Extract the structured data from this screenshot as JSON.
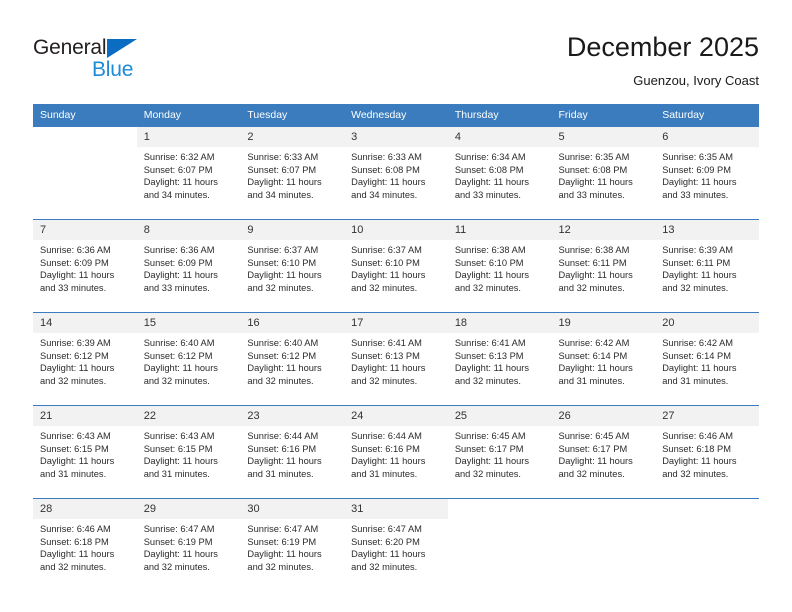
{
  "brand": {
    "name_line1": "General",
    "name_line2": "Blue",
    "triangle_color": "#0a6dc2",
    "blue_color": "#1e8bd6"
  },
  "header": {
    "title": "December 2025",
    "subtitle": "Guenzou, Ivory Coast"
  },
  "theme": {
    "header_blue": "#3a7cbe",
    "daynum_band": "#f2f2f2",
    "text_color": "#2b2b2b"
  },
  "weekday_headers": [
    "Sunday",
    "Monday",
    "Tuesday",
    "Wednesday",
    "Thursday",
    "Friday",
    "Saturday"
  ],
  "labels": {
    "sunrise_prefix": "Sunrise:",
    "sunset_prefix": "Sunset:",
    "daylight_prefix": "Daylight:"
  },
  "weeks": [
    [
      {
        "day": "",
        "sunrise": "",
        "sunset": "",
        "daylight_line1": "",
        "daylight_line2": ""
      },
      {
        "day": "1",
        "sunrise": "Sunrise: 6:32 AM",
        "sunset": "Sunset: 6:07 PM",
        "daylight_line1": "Daylight: 11 hours",
        "daylight_line2": "and 34 minutes."
      },
      {
        "day": "2",
        "sunrise": "Sunrise: 6:33 AM",
        "sunset": "Sunset: 6:07 PM",
        "daylight_line1": "Daylight: 11 hours",
        "daylight_line2": "and 34 minutes."
      },
      {
        "day": "3",
        "sunrise": "Sunrise: 6:33 AM",
        "sunset": "Sunset: 6:08 PM",
        "daylight_line1": "Daylight: 11 hours",
        "daylight_line2": "and 34 minutes."
      },
      {
        "day": "4",
        "sunrise": "Sunrise: 6:34 AM",
        "sunset": "Sunset: 6:08 PM",
        "daylight_line1": "Daylight: 11 hours",
        "daylight_line2": "and 33 minutes."
      },
      {
        "day": "5",
        "sunrise": "Sunrise: 6:35 AM",
        "sunset": "Sunset: 6:08 PM",
        "daylight_line1": "Daylight: 11 hours",
        "daylight_line2": "and 33 minutes."
      },
      {
        "day": "6",
        "sunrise": "Sunrise: 6:35 AM",
        "sunset": "Sunset: 6:09 PM",
        "daylight_line1": "Daylight: 11 hours",
        "daylight_line2": "and 33 minutes."
      }
    ],
    [
      {
        "day": "7",
        "sunrise": "Sunrise: 6:36 AM",
        "sunset": "Sunset: 6:09 PM",
        "daylight_line1": "Daylight: 11 hours",
        "daylight_line2": "and 33 minutes."
      },
      {
        "day": "8",
        "sunrise": "Sunrise: 6:36 AM",
        "sunset": "Sunset: 6:09 PM",
        "daylight_line1": "Daylight: 11 hours",
        "daylight_line2": "and 33 minutes."
      },
      {
        "day": "9",
        "sunrise": "Sunrise: 6:37 AM",
        "sunset": "Sunset: 6:10 PM",
        "daylight_line1": "Daylight: 11 hours",
        "daylight_line2": "and 32 minutes."
      },
      {
        "day": "10",
        "sunrise": "Sunrise: 6:37 AM",
        "sunset": "Sunset: 6:10 PM",
        "daylight_line1": "Daylight: 11 hours",
        "daylight_line2": "and 32 minutes."
      },
      {
        "day": "11",
        "sunrise": "Sunrise: 6:38 AM",
        "sunset": "Sunset: 6:10 PM",
        "daylight_line1": "Daylight: 11 hours",
        "daylight_line2": "and 32 minutes."
      },
      {
        "day": "12",
        "sunrise": "Sunrise: 6:38 AM",
        "sunset": "Sunset: 6:11 PM",
        "daylight_line1": "Daylight: 11 hours",
        "daylight_line2": "and 32 minutes."
      },
      {
        "day": "13",
        "sunrise": "Sunrise: 6:39 AM",
        "sunset": "Sunset: 6:11 PM",
        "daylight_line1": "Daylight: 11 hours",
        "daylight_line2": "and 32 minutes."
      }
    ],
    [
      {
        "day": "14",
        "sunrise": "Sunrise: 6:39 AM",
        "sunset": "Sunset: 6:12 PM",
        "daylight_line1": "Daylight: 11 hours",
        "daylight_line2": "and 32 minutes."
      },
      {
        "day": "15",
        "sunrise": "Sunrise: 6:40 AM",
        "sunset": "Sunset: 6:12 PM",
        "daylight_line1": "Daylight: 11 hours",
        "daylight_line2": "and 32 minutes."
      },
      {
        "day": "16",
        "sunrise": "Sunrise: 6:40 AM",
        "sunset": "Sunset: 6:12 PM",
        "daylight_line1": "Daylight: 11 hours",
        "daylight_line2": "and 32 minutes."
      },
      {
        "day": "17",
        "sunrise": "Sunrise: 6:41 AM",
        "sunset": "Sunset: 6:13 PM",
        "daylight_line1": "Daylight: 11 hours",
        "daylight_line2": "and 32 minutes."
      },
      {
        "day": "18",
        "sunrise": "Sunrise: 6:41 AM",
        "sunset": "Sunset: 6:13 PM",
        "daylight_line1": "Daylight: 11 hours",
        "daylight_line2": "and 32 minutes."
      },
      {
        "day": "19",
        "sunrise": "Sunrise: 6:42 AM",
        "sunset": "Sunset: 6:14 PM",
        "daylight_line1": "Daylight: 11 hours",
        "daylight_line2": "and 31 minutes."
      },
      {
        "day": "20",
        "sunrise": "Sunrise: 6:42 AM",
        "sunset": "Sunset: 6:14 PM",
        "daylight_line1": "Daylight: 11 hours",
        "daylight_line2": "and 31 minutes."
      }
    ],
    [
      {
        "day": "21",
        "sunrise": "Sunrise: 6:43 AM",
        "sunset": "Sunset: 6:15 PM",
        "daylight_line1": "Daylight: 11 hours",
        "daylight_line2": "and 31 minutes."
      },
      {
        "day": "22",
        "sunrise": "Sunrise: 6:43 AM",
        "sunset": "Sunset: 6:15 PM",
        "daylight_line1": "Daylight: 11 hours",
        "daylight_line2": "and 31 minutes."
      },
      {
        "day": "23",
        "sunrise": "Sunrise: 6:44 AM",
        "sunset": "Sunset: 6:16 PM",
        "daylight_line1": "Daylight: 11 hours",
        "daylight_line2": "and 31 minutes."
      },
      {
        "day": "24",
        "sunrise": "Sunrise: 6:44 AM",
        "sunset": "Sunset: 6:16 PM",
        "daylight_line1": "Daylight: 11 hours",
        "daylight_line2": "and 31 minutes."
      },
      {
        "day": "25",
        "sunrise": "Sunrise: 6:45 AM",
        "sunset": "Sunset: 6:17 PM",
        "daylight_line1": "Daylight: 11 hours",
        "daylight_line2": "and 32 minutes."
      },
      {
        "day": "26",
        "sunrise": "Sunrise: 6:45 AM",
        "sunset": "Sunset: 6:17 PM",
        "daylight_line1": "Daylight: 11 hours",
        "daylight_line2": "and 32 minutes."
      },
      {
        "day": "27",
        "sunrise": "Sunrise: 6:46 AM",
        "sunset": "Sunset: 6:18 PM",
        "daylight_line1": "Daylight: 11 hours",
        "daylight_line2": "and 32 minutes."
      }
    ],
    [
      {
        "day": "28",
        "sunrise": "Sunrise: 6:46 AM",
        "sunset": "Sunset: 6:18 PM",
        "daylight_line1": "Daylight: 11 hours",
        "daylight_line2": "and 32 minutes."
      },
      {
        "day": "29",
        "sunrise": "Sunrise: 6:47 AM",
        "sunset": "Sunset: 6:19 PM",
        "daylight_line1": "Daylight: 11 hours",
        "daylight_line2": "and 32 minutes."
      },
      {
        "day": "30",
        "sunrise": "Sunrise: 6:47 AM",
        "sunset": "Sunset: 6:19 PM",
        "daylight_line1": "Daylight: 11 hours",
        "daylight_line2": "and 32 minutes."
      },
      {
        "day": "31",
        "sunrise": "Sunrise: 6:47 AM",
        "sunset": "Sunset: 6:20 PM",
        "daylight_line1": "Daylight: 11 hours",
        "daylight_line2": "and 32 minutes."
      },
      {
        "day": "",
        "sunrise": "",
        "sunset": "",
        "daylight_line1": "",
        "daylight_line2": ""
      },
      {
        "day": "",
        "sunrise": "",
        "sunset": "",
        "daylight_line1": "",
        "daylight_line2": ""
      },
      {
        "day": "",
        "sunrise": "",
        "sunset": "",
        "daylight_line1": "",
        "daylight_line2": ""
      }
    ]
  ]
}
